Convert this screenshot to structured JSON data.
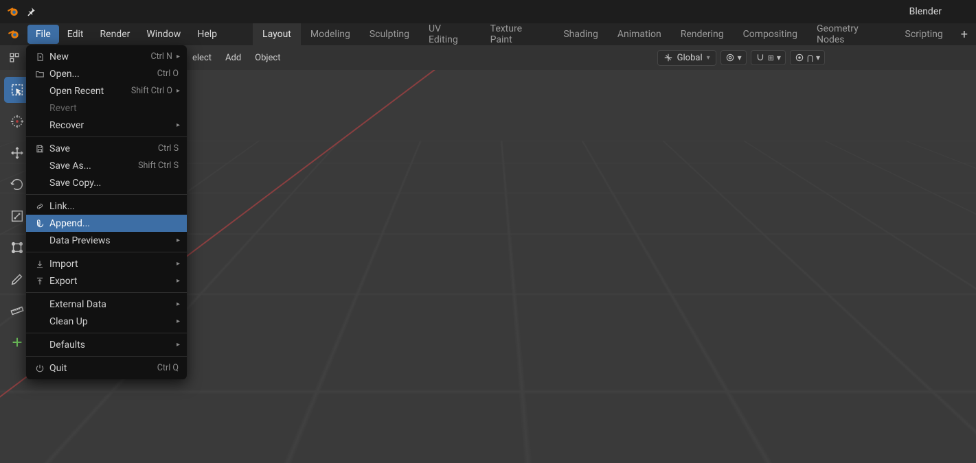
{
  "app": {
    "title": "Blender"
  },
  "main_menu": {
    "items": [
      "File",
      "Edit",
      "Render",
      "Window",
      "Help"
    ],
    "active_index": 0
  },
  "workspaces": {
    "tabs": [
      "Layout",
      "Modeling",
      "Sculpting",
      "UV Editing",
      "Texture Paint",
      "Shading",
      "Animation",
      "Rendering",
      "Compositing",
      "Geometry Nodes",
      "Scripting"
    ],
    "active_index": 0,
    "add_label": "+"
  },
  "header": {
    "select_label": "elect",
    "add_label": "Add",
    "object_label": "Object",
    "orientation": {
      "label": "Global"
    }
  },
  "file_menu": {
    "groups": [
      [
        {
          "icon": "doc-plus",
          "label": "New",
          "shortcut": "Ctrl N",
          "submenu": true
        },
        {
          "icon": "folder",
          "label": "Open...",
          "shortcut": "Ctrl O"
        },
        {
          "icon": "",
          "label": "Open Recent",
          "shortcut": "Shift Ctrl O",
          "submenu": true
        },
        {
          "icon": "",
          "label": "Revert",
          "disabled": true
        },
        {
          "icon": "",
          "label": "Recover",
          "submenu": true
        }
      ],
      [
        {
          "icon": "save",
          "label": "Save",
          "shortcut": "Ctrl S"
        },
        {
          "icon": "",
          "label": "Save As...",
          "shortcut": "Shift Ctrl S"
        },
        {
          "icon": "",
          "label": "Save Copy..."
        }
      ],
      [
        {
          "icon": "link",
          "label": "Link..."
        },
        {
          "icon": "append",
          "label": "Append...",
          "highlight": true
        },
        {
          "icon": "",
          "label": "Data Previews",
          "submenu": true
        }
      ],
      [
        {
          "icon": "import",
          "label": "Import",
          "submenu": true
        },
        {
          "icon": "export",
          "label": "Export",
          "submenu": true
        }
      ],
      [
        {
          "icon": "",
          "label": "External Data",
          "submenu": true
        },
        {
          "icon": "",
          "label": "Clean Up",
          "submenu": true
        }
      ],
      [
        {
          "icon": "",
          "label": "Defaults",
          "submenu": true
        }
      ],
      [
        {
          "icon": "power",
          "label": "Quit",
          "shortcut": "Ctrl Q"
        }
      ]
    ]
  },
  "tools": [
    {
      "name": "select-box-tool",
      "active": true
    },
    {
      "name": "cursor-tool"
    },
    {
      "name": "move-tool"
    },
    {
      "name": "rotate-tool"
    },
    {
      "name": "scale-tool"
    },
    {
      "name": "transform-tool"
    },
    {
      "name": "annotate-tool"
    },
    {
      "name": "measure-tool"
    },
    {
      "name": "add-tool"
    }
  ]
}
